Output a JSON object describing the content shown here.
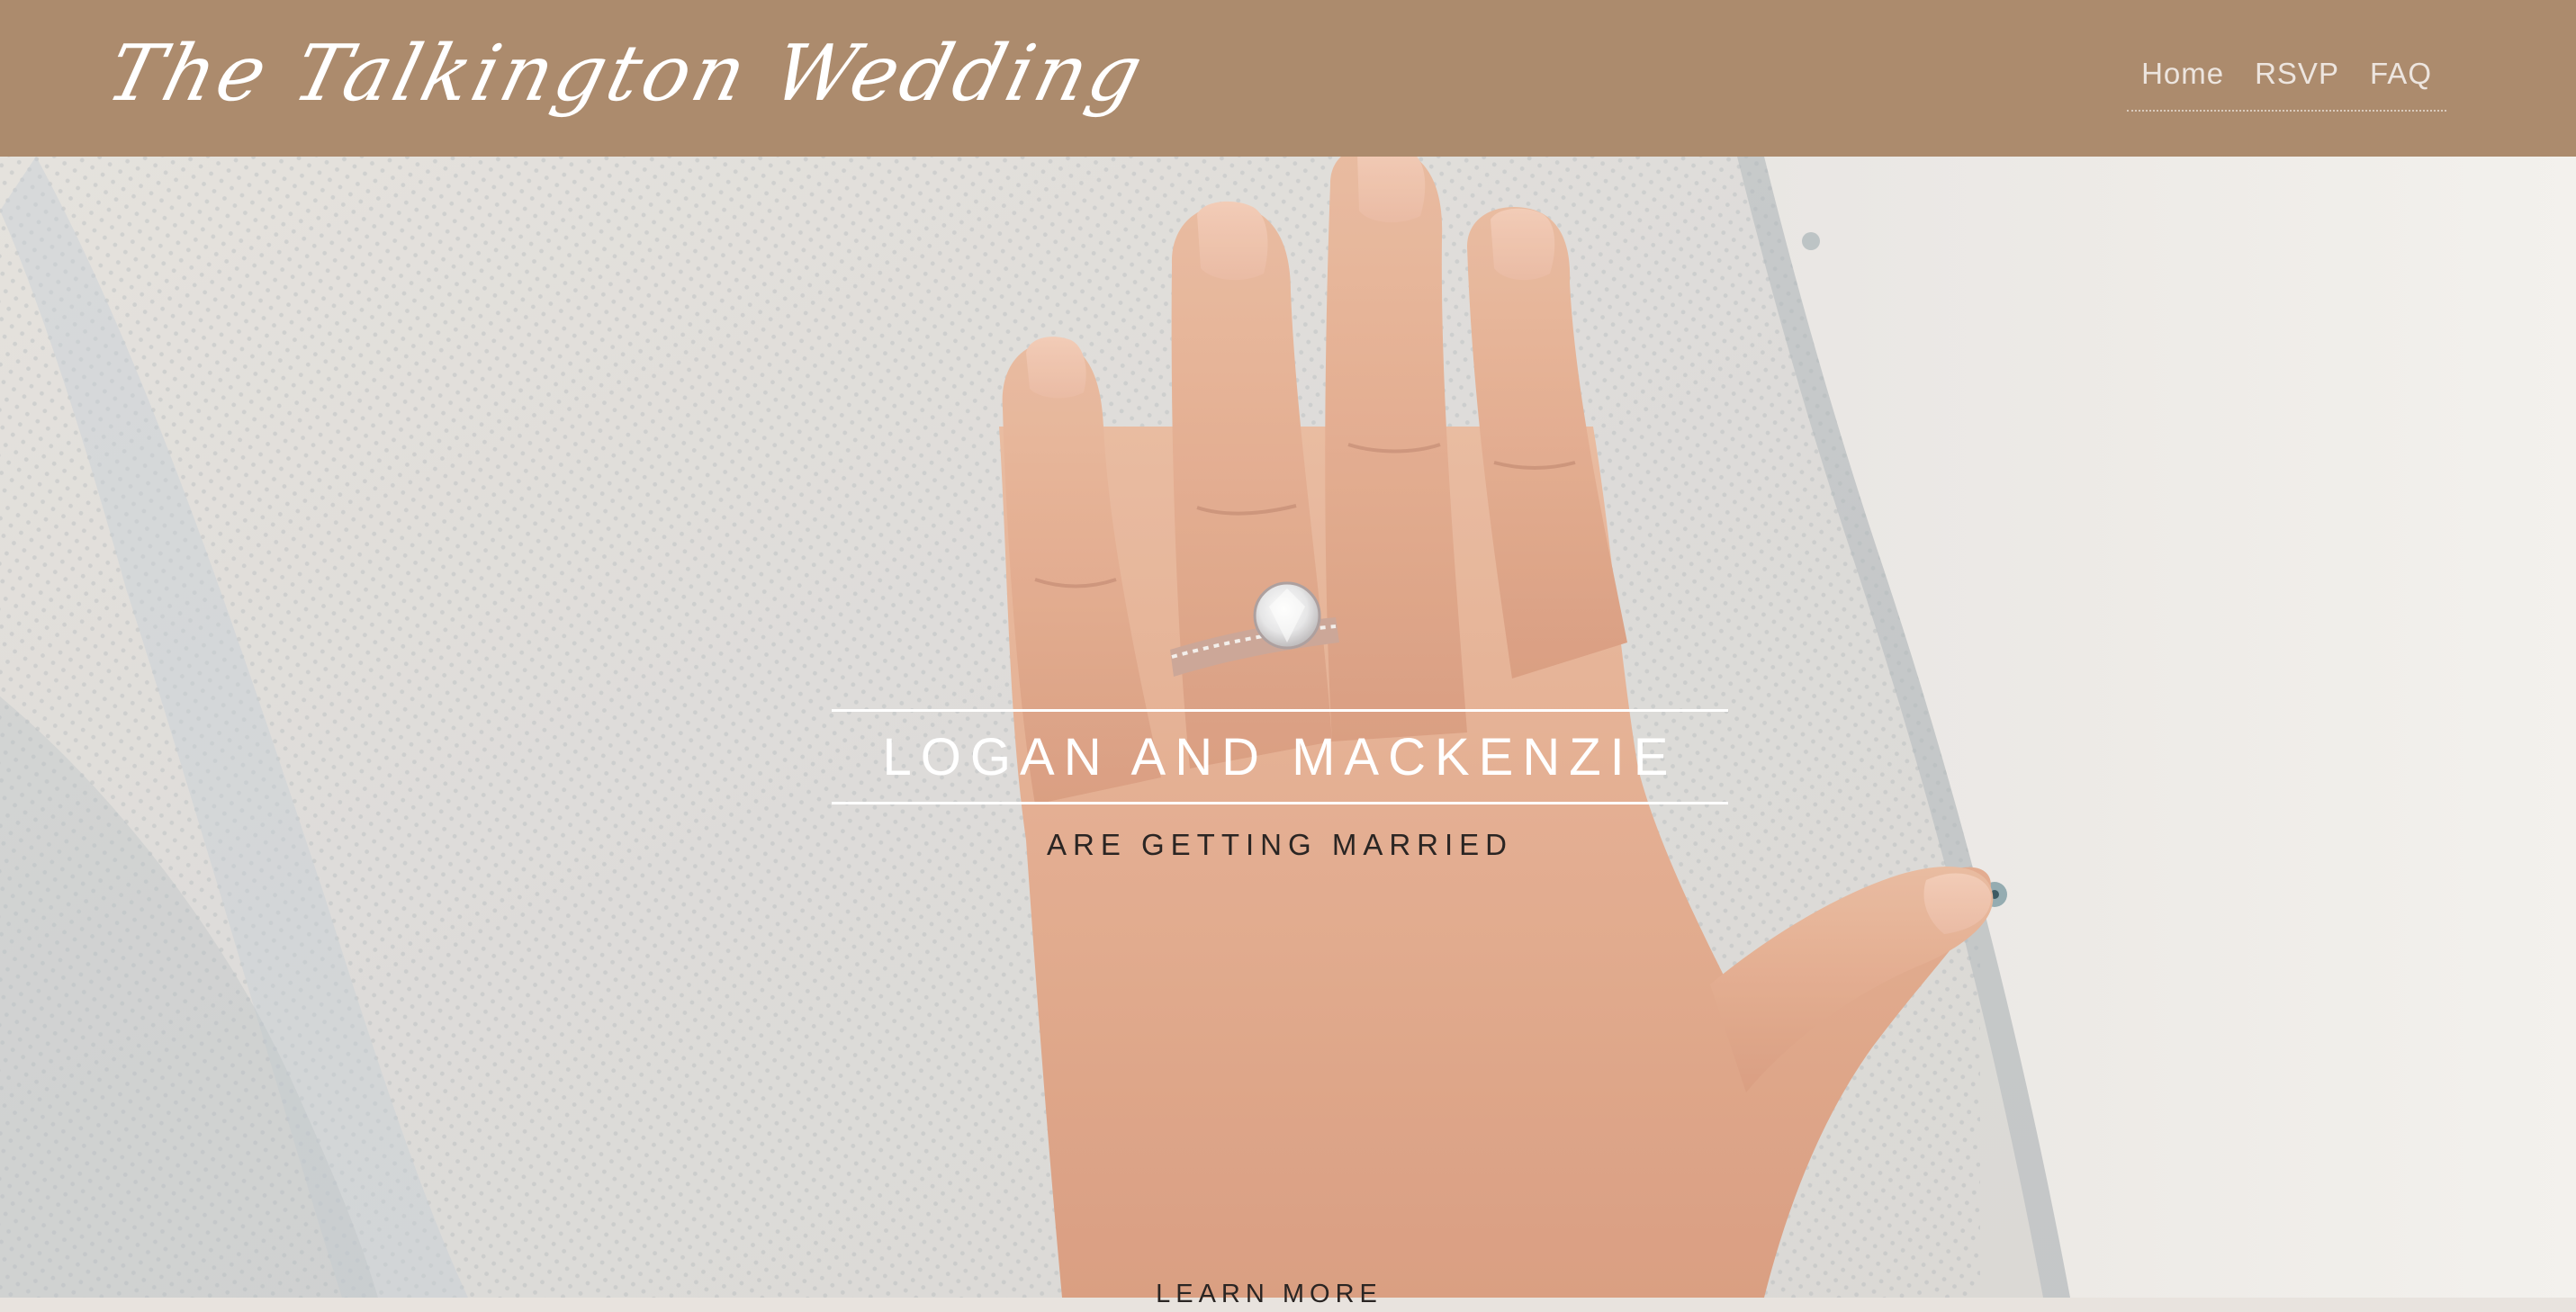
{
  "header": {
    "site_title": "The Talkington Wedding",
    "background_color": "#ac8b6d",
    "nav": [
      {
        "label": "Home"
      },
      {
        "label": "RSVP"
      },
      {
        "label": "FAQ"
      }
    ]
  },
  "hero": {
    "image_icon": "engagement-ring-hand-photo",
    "couple_names": "LOGAN AND MACKENZIE",
    "subtitle": "ARE GETTING MARRIED",
    "learn_more": "LEARN MORE"
  }
}
